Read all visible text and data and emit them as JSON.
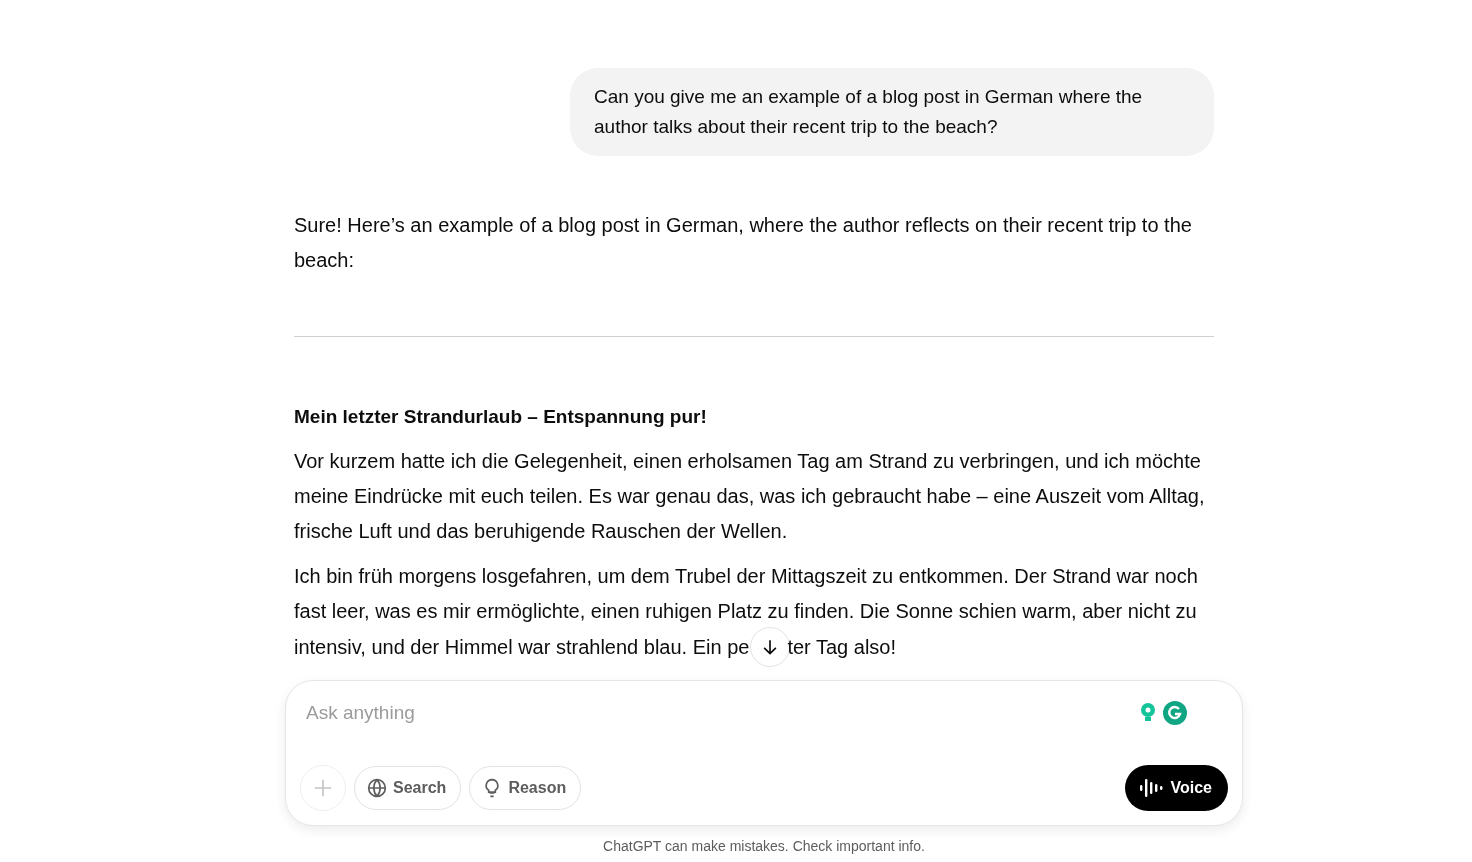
{
  "messages": [
    {
      "kind": "user",
      "text": "Can you give me an example of a blog post in German where the author talks about their recent trip to the beach?"
    },
    {
      "kind": "assistant",
      "blocks": [
        {
          "kind": "paragraph",
          "text": "Sure! Here’s an example of a blog post in German, where the author reflects on their recent trip to the beach:"
        },
        {
          "kind": "divider"
        },
        {
          "kind": "heading",
          "text": "Mein letzter Strandurlaub – Entspannung pur!"
        },
        {
          "kind": "paragraph",
          "text": "Vor kurzem hatte ich die Gelegenheit, einen erholsamen Tag am Strand zu verbringen, und ich möchte meine Eindrücke mit euch teilen. Es war genau das, was ich gebraucht habe – eine Auszeit vom Alltag, frische Luft und das beruhigende Rauschen der Wellen."
        },
        {
          "kind": "paragraph_start",
          "text": "Ich bin früh morgens losgefahren, um dem Trubel der Mittagszeit zu entkommen. Der Strand war noch fast leer, was es mir ermöglichte, einen ruhigen Platz zu finden. Die Sonne schien warm, aber nicht zu"
        },
        {
          "kind": "covered_line",
          "before": "intensiv, und der Himmel war strahlend blau. Ein pe",
          "after": "ter Tag also!"
        }
      ]
    }
  ],
  "composer": {
    "placeholder": "Ask anything",
    "tools": [
      {
        "kind": "plus"
      },
      {
        "kind": "globe",
        "label": "Search"
      },
      {
        "kind": "bulb",
        "label": "Reason"
      }
    ],
    "voice": "Voice"
  },
  "footer": "ChatGPT can make mistakes. Check important info."
}
